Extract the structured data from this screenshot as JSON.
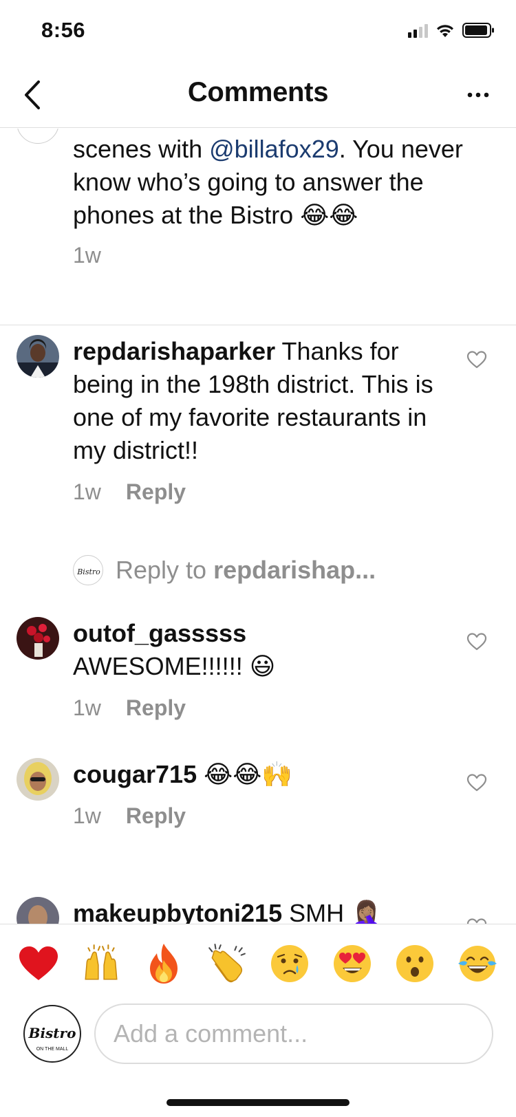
{
  "status": {
    "time": "8:56"
  },
  "nav": {
    "title": "Comments"
  },
  "caption": {
    "text_before": "scenes with ",
    "mention": "@billafox29",
    "text_after": ". You never know who’s going to answer the phones at the Bistro ",
    "time": "1w"
  },
  "comments": [
    {
      "username": "repdarishaparker",
      "text": " Thanks for being in the 198th district. This is one of my favorite restaurants in my district!!",
      "time": "1w",
      "reply_label": "Reply",
      "reply_to_prefix": "Reply to ",
      "reply_to_user": "repdarishap..."
    },
    {
      "username": "outof_gasssss",
      "text": "AWESOME!!!!!! ",
      "time": "1w",
      "reply_label": "Reply"
    },
    {
      "username": "cougar715",
      "text": " ",
      "time": "1w",
      "reply_label": "Reply"
    },
    {
      "username": "makeupbytoni215",
      "text": " SMH "
    }
  ],
  "emoji_bar": [
    {
      "name": "red-heart-icon"
    },
    {
      "name": "raising-hands-icon"
    },
    {
      "name": "fire-icon"
    },
    {
      "name": "clapping-hands-icon"
    },
    {
      "name": "crying-face-icon"
    },
    {
      "name": "heart-eyes-face-icon"
    },
    {
      "name": "surprised-face-icon"
    },
    {
      "name": "tears-of-joy-face-icon"
    }
  ],
  "composer": {
    "placeholder": "Add a comment...",
    "logo_text": "Bistro",
    "logo_subtext": "ON THE MALL"
  },
  "colors": {
    "mention": "#1b3b6f",
    "muted": "#8e8e8e",
    "divider": "#dedede"
  }
}
